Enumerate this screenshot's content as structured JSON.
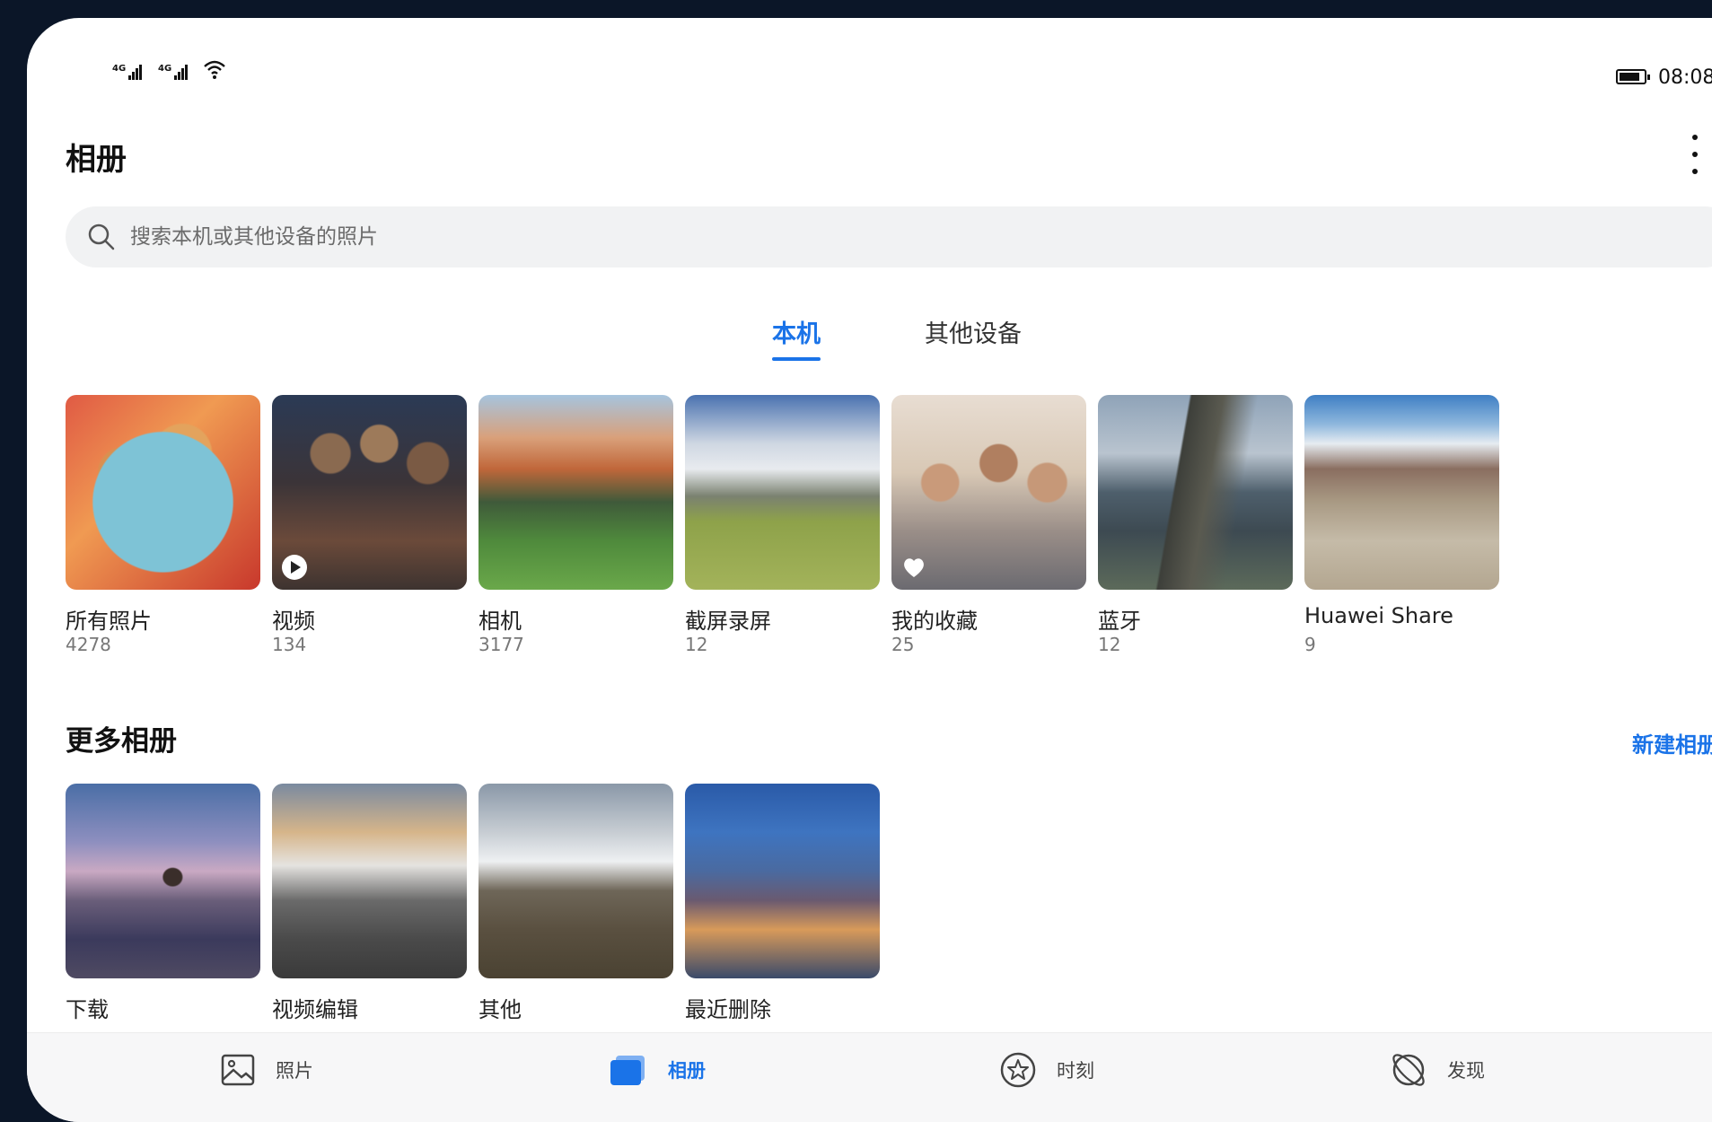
{
  "status_bar": {
    "sim1_type": "4G",
    "sim2_type": "4G",
    "time": "08:08",
    "battery_level": 0.85
  },
  "header": {
    "title": "相册"
  },
  "search": {
    "placeholder": "搜索本机或其他设备的照片"
  },
  "tabs": [
    {
      "label": "本机",
      "active": true
    },
    {
      "label": "其他设备",
      "active": false
    }
  ],
  "albums": [
    {
      "name": "所有照片",
      "count": "4278"
    },
    {
      "name": "视频",
      "count": "134"
    },
    {
      "name": "相机",
      "count": "3177"
    },
    {
      "name": "截屏录屏",
      "count": "12"
    },
    {
      "name": "我的收藏",
      "count": "25"
    },
    {
      "name": "蓝牙",
      "count": "12"
    },
    {
      "name": "Huawei Share",
      "count": "9"
    }
  ],
  "more_albums": {
    "title": "更多相册",
    "new_album_label": "新建相册",
    "items": [
      {
        "name": "下载"
      },
      {
        "name": "视频编辑"
      },
      {
        "name": "其他"
      },
      {
        "name": "最近删除"
      }
    ]
  },
  "bottom_nav": [
    {
      "label": "照片",
      "icon": "image-icon",
      "active": false
    },
    {
      "label": "相册",
      "icon": "album-icon",
      "active": true
    },
    {
      "label": "时刻",
      "icon": "star-circle-icon",
      "active": false
    },
    {
      "label": "发现",
      "icon": "discover-icon",
      "active": false
    }
  ],
  "colors": {
    "accent": "#1a73e8",
    "background": "#ffffff",
    "frame": "#0b1628"
  }
}
